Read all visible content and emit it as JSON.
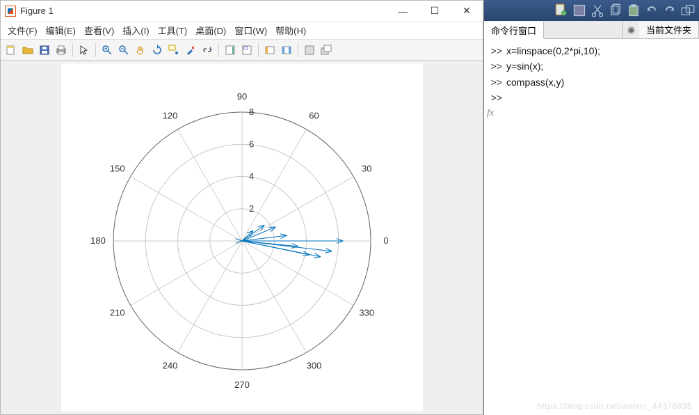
{
  "figure": {
    "title": "Figure 1",
    "menus": [
      "文件(F)",
      "编辑(E)",
      "查看(V)",
      "插入(I)",
      "工具(T)",
      "桌面(D)",
      "窗口(W)",
      "帮助(H)"
    ],
    "winControls": {
      "min": "—",
      "max": "☐",
      "close": "✕"
    }
  },
  "chart_data": {
    "type": "compass",
    "angle_labels": [
      "0",
      "30",
      "60",
      "90",
      "120",
      "150",
      "180",
      "210",
      "240",
      "270",
      "300",
      "330"
    ],
    "radial_ticks": [
      2,
      4,
      6,
      8
    ],
    "rlim": [
      0,
      8
    ],
    "vectors": [
      {
        "x": 0.0,
        "y": 0.0
      },
      {
        "x": 0.698,
        "y": 0.643
      },
      {
        "x": 1.396,
        "y": 0.985
      },
      {
        "x": 2.094,
        "y": 0.866
      },
      {
        "x": 2.793,
        "y": 0.342
      },
      {
        "x": 3.491,
        "y": -0.342
      },
      {
        "x": 4.189,
        "y": -0.866
      },
      {
        "x": 4.887,
        "y": -0.985
      },
      {
        "x": 5.585,
        "y": -0.643
      },
      {
        "x": 6.283,
        "y": 0.0
      }
    ],
    "line_color": "#0072BD"
  },
  "right": {
    "tabs": {
      "cmd": "命令行窗口",
      "folder": "当前文件夹"
    },
    "lines": [
      "x=linspace(0,2*pi,10);",
      "y=sin(x);",
      "compass(x,y)",
      ""
    ],
    "prompt": ">>",
    "fx": "fx"
  },
  "watermark": "https://blog.csdn.net/weixin_44378835"
}
